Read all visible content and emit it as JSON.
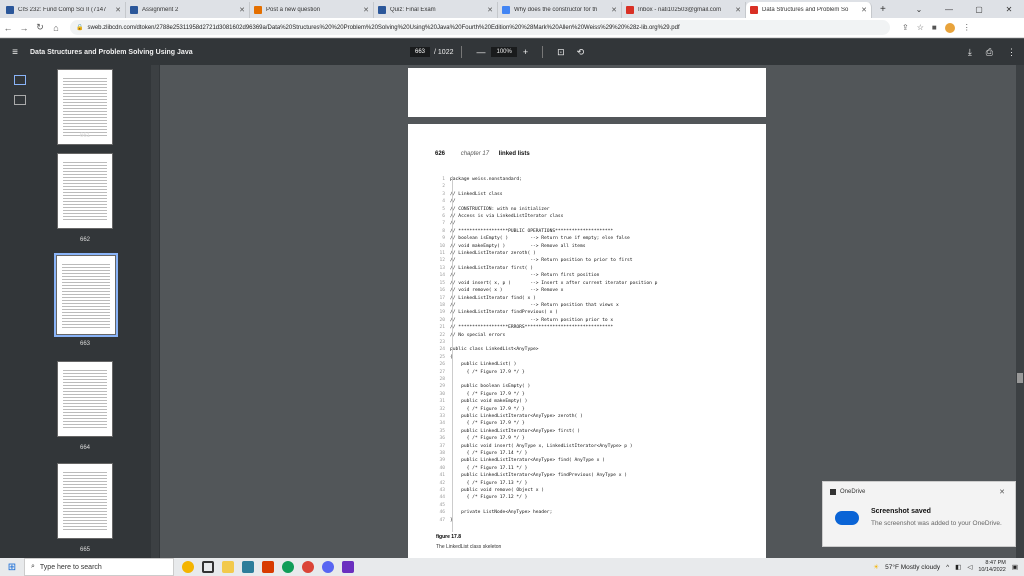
{
  "tabs": [
    {
      "title": "CIS 232: Fund Comp Sci II (7147",
      "color": "#2b579a"
    },
    {
      "title": "Assignment 2",
      "color": "#2b579a"
    },
    {
      "title": "Post a new question",
      "color": "#e46f00"
    },
    {
      "title": "Quiz: Final Exam",
      "color": "#2b579a"
    },
    {
      "title": "Why does the constructor for th",
      "color": "#4285f4"
    },
    {
      "title": "Inbox - nati102503@gmail.com",
      "color": "#d93025"
    },
    {
      "title": "Data Structures and Problem So",
      "color": "#d93025",
      "active": true
    }
  ],
  "address": {
    "url": "sweb.zlibcdn.com/dtoken/2788e25311958d2721d3081602d96369a/Data%20Structures%20%20Problem%20Solving%20Using%20Java%20Fourth%20Edition%20%28Mark%20Allen%20Weiss%29%20%28z-lib.org%29.pdf"
  },
  "pdf": {
    "title": "Data Structures and Problem Solving Using Java",
    "page_current": "663",
    "page_total": "/ 1022",
    "zoom": "100%"
  },
  "thumbs": [
    {
      "num": "661"
    },
    {
      "num": "662"
    },
    {
      "num": "663",
      "selected": true
    },
    {
      "num": "664"
    },
    {
      "num": "665"
    }
  ],
  "page": {
    "number": "626",
    "chapter": "chapter 17",
    "chapter_title": "linked lists",
    "code": [
      "package weiss.nonstandard;",
      "",
      "// LinkedList class",
      "//",
      "// CONSTRUCTION: with no initializer",
      "// Access is via LinkedListIterator class",
      "//",
      "// ******************PUBLIC OPERATIONS*********************",
      "// boolean isEmpty( )        --> Return true if empty; else false",
      "// void makeEmpty( )         --> Remove all items",
      "// LinkedListIterator zeroth( )",
      "//                           --> Return position to prior to first",
      "// LinkedListIterator first( )",
      "//                           --> Return first position",
      "// void insert( x, p )       --> Insert x after current iterator position p",
      "// void remove( x )          --> Remove x",
      "// LinkedListIterator find( x )",
      "//                           --> Return position that views x",
      "// LinkedListIterator findPrevious( x )",
      "//                           --> Return position prior to x",
      "// ******************ERRORS********************************",
      "// No special errors",
      "",
      "public class LinkedList<AnyType>",
      "{",
      "    public LinkedList( )",
      "      { /* Figure 17.9 */ }",
      "",
      "    public boolean isEmpty( )",
      "      { /* Figure 17.9 */ }",
      "    public void makeEmpty( )",
      "      { /* Figure 17.9 */ }",
      "    public LinkedListIterator<AnyType> zeroth( )",
      "      { /* Figure 17.9 */ }",
      "    public LinkedListIterator<AnyType> first( )",
      "      { /* Figure 17.9 */ }",
      "    public void insert( AnyType x, LinkedListIterator<AnyType> p )",
      "      { /* Figure 17.14 */ }",
      "    public LinkedListIterator<AnyType> find( AnyType x )",
      "      { /* Figure 17.11 */ }",
      "    public LinkedListIterator<AnyType> findPrevious( AnyType x )",
      "      { /* Figure 17.13 */ }",
      "    public void remove( Object x )",
      "      { /* Figure 17.12 */ }",
      "",
      "    private ListNode<AnyType> header;",
      "}"
    ],
    "figure_label": "figure 17.8",
    "figure_desc": "The LinkedList class skeleton"
  },
  "toast": {
    "app": "OneDrive",
    "heading": "Screenshot saved",
    "body": "The screenshot was added to your OneDrive."
  },
  "taskbar": {
    "search_placeholder": "Type here to search",
    "weather": "57°F  Mostly cloudy",
    "time": "8:47 PM",
    "date": "10/14/2022"
  }
}
